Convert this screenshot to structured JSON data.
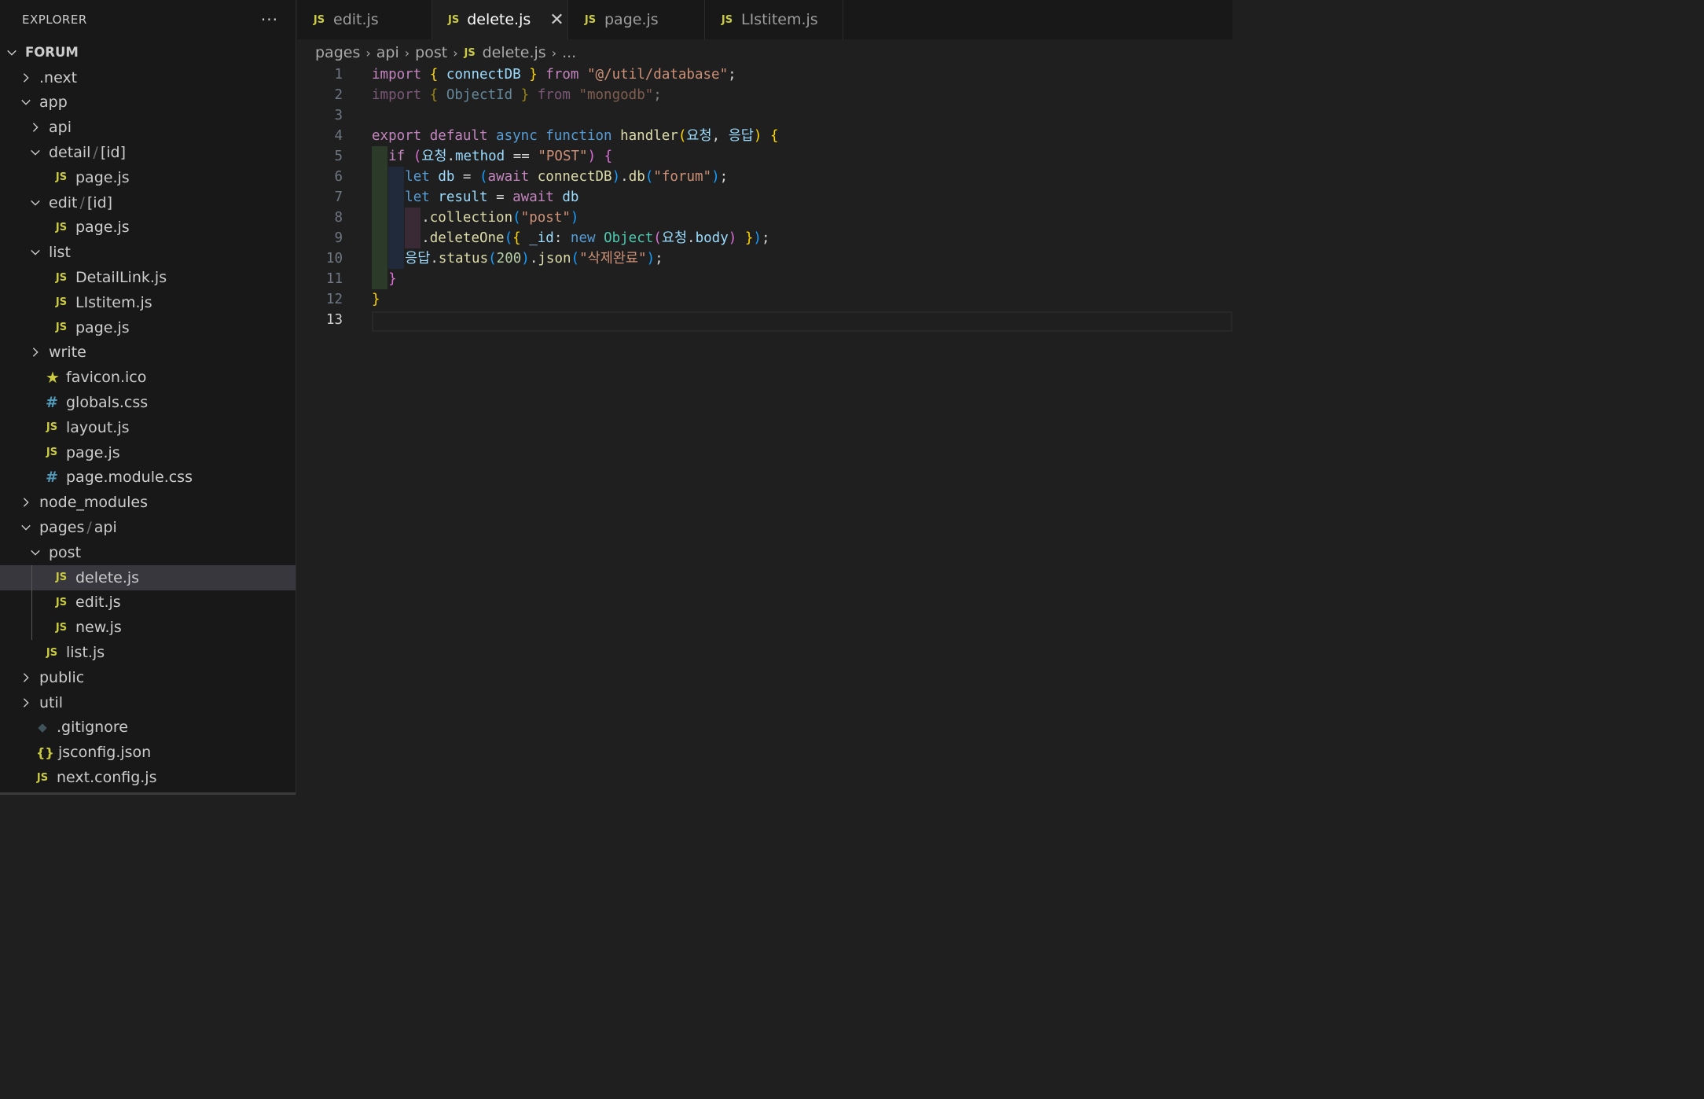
{
  "sidebar": {
    "title": "EXPLORER",
    "more": "···",
    "root": "FORUM",
    "items": [
      {
        "label": ".next",
        "type": "folder",
        "expanded": false
      },
      {
        "label": "app",
        "type": "folder",
        "expanded": true
      },
      {
        "label": "api",
        "type": "folder",
        "expanded": false
      },
      {
        "label": "detail",
        "label2": "[id]",
        "sep": "/",
        "type": "folder",
        "expanded": true
      },
      {
        "label": "page.js",
        "type": "js"
      },
      {
        "label": "edit",
        "label2": "[id]",
        "sep": "/",
        "type": "folder",
        "expanded": true
      },
      {
        "label": "page.js",
        "type": "js"
      },
      {
        "label": "list",
        "type": "folder",
        "expanded": true
      },
      {
        "label": "DetailLink.js",
        "type": "js"
      },
      {
        "label": "LIstitem.js",
        "type": "js"
      },
      {
        "label": "page.js",
        "type": "js"
      },
      {
        "label": "write",
        "type": "folder",
        "expanded": false
      },
      {
        "label": "favicon.ico",
        "type": "ico"
      },
      {
        "label": "globals.css",
        "type": "css"
      },
      {
        "label": "layout.js",
        "type": "js"
      },
      {
        "label": "page.js",
        "type": "js"
      },
      {
        "label": "page.module.css",
        "type": "css"
      },
      {
        "label": "node_modules",
        "type": "folder",
        "expanded": false
      },
      {
        "label": "pages",
        "label2": "api",
        "sep": "/",
        "type": "folder",
        "expanded": true
      },
      {
        "label": "post",
        "type": "folder",
        "expanded": true
      },
      {
        "label": "delete.js",
        "type": "js",
        "selected": true
      },
      {
        "label": "edit.js",
        "type": "js"
      },
      {
        "label": "new.js",
        "type": "js"
      },
      {
        "label": "list.js",
        "type": "js"
      },
      {
        "label": "public",
        "type": "folder",
        "expanded": false
      },
      {
        "label": "util",
        "type": "folder",
        "expanded": false
      },
      {
        "label": ".gitignore",
        "type": "git"
      },
      {
        "label": "jsconfig.json",
        "type": "json"
      },
      {
        "label": "next.config.js",
        "type": "js"
      }
    ]
  },
  "tabs": [
    {
      "label": "edit.js",
      "icon": "JS",
      "active": false
    },
    {
      "label": "delete.js",
      "icon": "JS",
      "active": true,
      "close": "✕"
    },
    {
      "label": "page.js",
      "icon": "JS",
      "active": false
    },
    {
      "label": "LIstitem.js",
      "icon": "JS",
      "active": false
    }
  ],
  "breadcrumb": {
    "parts": [
      "pages",
      "api",
      "post",
      "delete.js",
      "..."
    ],
    "icon": "JS"
  },
  "editor": {
    "line_numbers": [
      "1",
      "2",
      "3",
      "4",
      "5",
      "6",
      "7",
      "8",
      "9",
      "10",
      "11",
      "12",
      "13"
    ],
    "current_line": "13",
    "lines": [
      [
        [
          "k1",
          "import"
        ],
        [
          "p",
          " "
        ],
        [
          "b1",
          "{"
        ],
        [
          "v",
          " connectDB "
        ],
        [
          "b1",
          "}"
        ],
        [
          "k1",
          " from"
        ],
        [
          "p",
          " "
        ],
        [
          "s",
          "\"@/util/database\""
        ],
        [
          "p",
          ";"
        ]
      ],
      [
        [
          "k1 dim",
          "import"
        ],
        [
          "p dim",
          " "
        ],
        [
          "b1 dim",
          "{"
        ],
        [
          "v dim",
          " ObjectId "
        ],
        [
          "b1 dim",
          "}"
        ],
        [
          "k1 dim",
          " from"
        ],
        [
          "p dim",
          " "
        ],
        [
          "s dim",
          "\"mongodb\""
        ],
        [
          "p dim",
          ";"
        ]
      ],
      [],
      [
        [
          "k1",
          "export default "
        ],
        [
          "k2",
          "async function "
        ],
        [
          "fn",
          "handler"
        ],
        [
          "b1",
          "("
        ],
        [
          "v",
          "요청"
        ],
        [
          "p",
          ", "
        ],
        [
          "v",
          "응답"
        ],
        [
          "b1",
          ")"
        ],
        [
          "p",
          " "
        ],
        [
          "b1",
          "{"
        ]
      ],
      [
        [
          "p",
          "  "
        ],
        [
          "k1",
          "if "
        ],
        [
          "b2",
          "("
        ],
        [
          "v",
          "요청"
        ],
        [
          "p",
          "."
        ],
        [
          "v",
          "method"
        ],
        [
          "p",
          " == "
        ],
        [
          "s",
          "\"POST\""
        ],
        [
          "b2",
          ")"
        ],
        [
          "p",
          " "
        ],
        [
          "b2",
          "{"
        ]
      ],
      [
        [
          "p",
          "    "
        ],
        [
          "k2",
          "let "
        ],
        [
          "v",
          "db"
        ],
        [
          "p",
          " = "
        ],
        [
          "b3",
          "("
        ],
        [
          "k1",
          "await "
        ],
        [
          "fn",
          "connectDB"
        ],
        [
          "b3",
          ")"
        ],
        [
          "p",
          "."
        ],
        [
          "fn",
          "db"
        ],
        [
          "b3",
          "("
        ],
        [
          "s",
          "\"forum\""
        ],
        [
          "b3",
          ")"
        ],
        [
          "p",
          ";"
        ]
      ],
      [
        [
          "p",
          "    "
        ],
        [
          "k2",
          "let "
        ],
        [
          "v",
          "result"
        ],
        [
          "p",
          " = "
        ],
        [
          "k1",
          "await "
        ],
        [
          "v",
          "db"
        ]
      ],
      [
        [
          "p",
          "      ."
        ],
        [
          "fn",
          "collection"
        ],
        [
          "b3",
          "("
        ],
        [
          "s",
          "\"post\""
        ],
        [
          "b3",
          ")"
        ]
      ],
      [
        [
          "p",
          "      ."
        ],
        [
          "fn",
          "deleteOne"
        ],
        [
          "b3",
          "("
        ],
        [
          "b1",
          "{"
        ],
        [
          "v",
          " _id"
        ],
        [
          "p",
          ": "
        ],
        [
          "k2",
          "new "
        ],
        [
          "t",
          "Object"
        ],
        [
          "b2",
          "("
        ],
        [
          "v",
          "요청"
        ],
        [
          "p",
          "."
        ],
        [
          "v",
          "body"
        ],
        [
          "b2",
          ")"
        ],
        [
          "p",
          " "
        ],
        [
          "b1",
          "}"
        ],
        [
          "b3",
          ")"
        ],
        [
          "p",
          ";"
        ]
      ],
      [
        [
          "p",
          "    "
        ],
        [
          "v",
          "응답"
        ],
        [
          "p",
          "."
        ],
        [
          "fn",
          "status"
        ],
        [
          "b3",
          "("
        ],
        [
          "n",
          "200"
        ],
        [
          "b3",
          ")"
        ],
        [
          "p",
          "."
        ],
        [
          "fn",
          "json"
        ],
        [
          "b3",
          "("
        ],
        [
          "s",
          "\"삭제완료\""
        ],
        [
          "b3",
          ")"
        ],
        [
          "p",
          ";"
        ]
      ],
      [
        [
          "p",
          "  "
        ],
        [
          "b2",
          "}"
        ]
      ],
      [
        [
          "b1",
          "}"
        ]
      ],
      []
    ]
  }
}
